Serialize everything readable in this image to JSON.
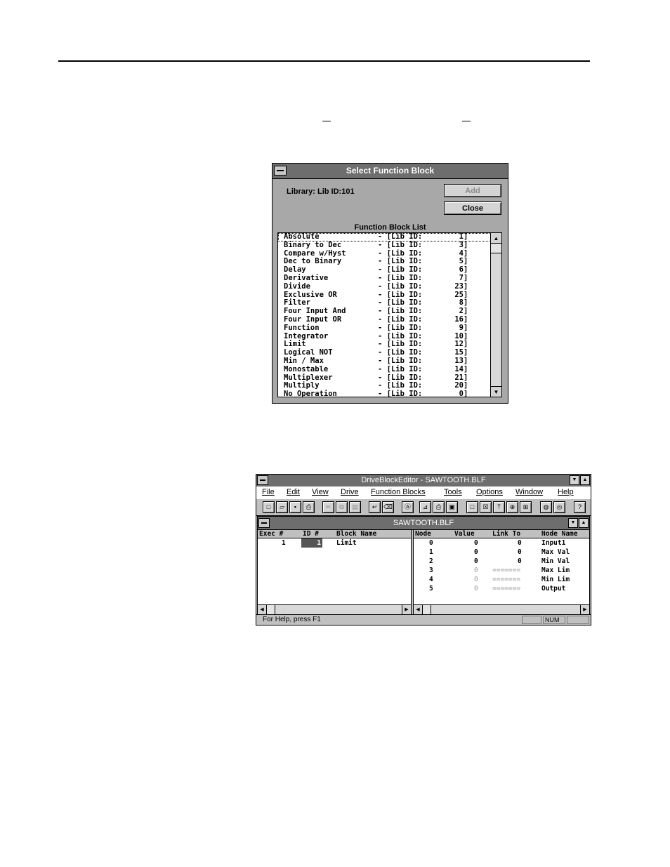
{
  "dialog": {
    "title": "Select Function Block",
    "library_label": "Library: Lib ID:101",
    "add_label": "Add",
    "close_label": "Close",
    "list_caption": "Function Block List",
    "items": [
      {
        "name": "Absolute",
        "id": "1"
      },
      {
        "name": "Binary to Dec",
        "id": "3"
      },
      {
        "name": "Compare w/Hyst",
        "id": "4"
      },
      {
        "name": "Dec to Binary",
        "id": "5"
      },
      {
        "name": "Delay",
        "id": "6"
      },
      {
        "name": "Derivative",
        "id": "7"
      },
      {
        "name": "Divide",
        "id": "23"
      },
      {
        "name": "Exclusive OR",
        "id": "25"
      },
      {
        "name": "Filter",
        "id": "8"
      },
      {
        "name": "Four Input And",
        "id": "2"
      },
      {
        "name": "Four Input OR",
        "id": "16"
      },
      {
        "name": "Function",
        "id": "9"
      },
      {
        "name": "Integrator",
        "id": "10"
      },
      {
        "name": "Limit",
        "id": "12"
      },
      {
        "name": "Logical NOT",
        "id": "15"
      },
      {
        "name": "Min / Max",
        "id": "13"
      },
      {
        "name": "Monostable",
        "id": "14"
      },
      {
        "name": "Multiplexer",
        "id": "21"
      },
      {
        "name": "Multiply",
        "id": "20"
      },
      {
        "name": "No Operation",
        "id": "0"
      }
    ],
    "lib_prefix": "- [Lib ID:",
    "lib_suffix": "]"
  },
  "app": {
    "title": "DriveBlockEditor - SAWTOOTH.BLF",
    "menu": [
      "File",
      "Edit",
      "View",
      "Drive",
      "Function Blocks",
      "Tools",
      "Options",
      "Window",
      "Help"
    ],
    "toolbar_icons": [
      "new-file-icon",
      "open-folder-icon",
      "save-icon",
      "print-icon",
      "cut-icon",
      "copy-icon",
      "paste-icon",
      "insert-block-icon",
      "delete-block-icon",
      "find-icon",
      "connect-icon",
      "print-preview-icon",
      "printer-icon",
      "block-icon",
      "block-x-icon",
      "block-up-icon",
      "block-add-icon",
      "block-plus-icon",
      "upload-icon",
      "download-icon",
      "help-icon"
    ],
    "toolbar_glyphs": [
      "□",
      "▱",
      "▪",
      "⎙",
      "✂",
      "⧉",
      "▤",
      "↵",
      "⌫",
      "Ⓐ",
      "⊿",
      "⎙",
      "▣",
      "□",
      "☒",
      "⤒",
      "⊕",
      "⊞",
      "◍",
      "◎",
      "?"
    ],
    "child_title": "SAWTOOTH.BLF",
    "left_headers": [
      "Exec #",
      "ID #",
      "Block Name"
    ],
    "blocks": [
      {
        "exec": "1",
        "id": "1",
        "name": "Limit"
      }
    ],
    "right_headers": [
      "Node",
      "Value",
      "Link To",
      "Node Name"
    ],
    "nodes": [
      {
        "node": "0",
        "value": "0",
        "link": "0",
        "name": "Input1",
        "dim": false
      },
      {
        "node": "1",
        "value": "0",
        "link": "0",
        "name": "Max Val",
        "dim": false
      },
      {
        "node": "2",
        "value": "0",
        "link": "0",
        "name": "Min Val",
        "dim": false
      },
      {
        "node": "3",
        "value": "0",
        "link": "=======",
        "name": "Max Lim",
        "dim": true
      },
      {
        "node": "4",
        "value": "0",
        "link": "=======",
        "name": "Min Lim",
        "dim": true
      },
      {
        "node": "5",
        "value": "0",
        "link": "=======",
        "name": "Output",
        "dim": true
      }
    ],
    "status_text": "For Help, press F1",
    "status_num": "NUM"
  }
}
